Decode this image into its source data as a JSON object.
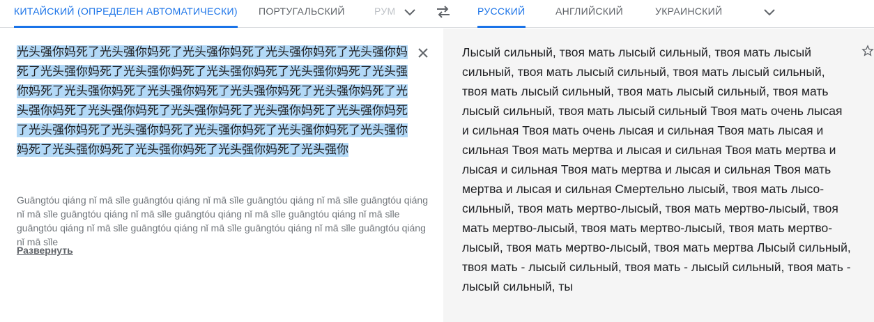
{
  "source_langs": {
    "detected": "КИТАЙСКИЙ (ОПРЕДЕЛЕН АВТОМАТИЧЕСКИ)",
    "portuguese": "ПОРТУГАЛЬСКИЙ",
    "partial": "РУМЫНСКИЙ"
  },
  "target_langs": {
    "russian": "РУССКИЙ",
    "english": "АНГЛИЙСКИЙ",
    "ukrainian": "УКРАИНСКИЙ"
  },
  "icons": {
    "more_source": "chevron-down-icon",
    "swap": "swap-arrows-icon",
    "more_target": "chevron-down-icon",
    "clear": "close-icon",
    "save": "star-icon"
  },
  "colors": {
    "accent": "#1a73e8",
    "selection": "#b3d9f7",
    "output_bg": "#f5f5f5"
  },
  "source": {
    "text": "光头强你妈死了光头强你妈死了光头强你妈死了光头强你妈死了光头强你妈死了光头强你妈死了光头强你妈死了光头强你妈死了光头强你妈死了光头强你妈死了光头强你妈死了光头强你妈死了光头强你妈死了光头强你妈死了光头强你妈死了光头强你妈死了光头强你妈死了光头强你妈死了光头强你妈死了光头强你妈死了光头强你妈死了光头强你妈死了光头强你妈死了光头强你妈死了光头强你妈死了光头强你妈死了光头强你妈死了光头强你",
    "transliteration": "Guāngtóu qiáng nǐ mā sǐle guāngtóu qiáng nǐ mā sǐle guāngtóu qiáng nǐ mā sǐle guāngtóu qiáng nǐ mā sǐle guāngtóu qiáng nǐ mā sǐle guāngtóu qiáng nǐ mā sǐle guāngtóu qiáng nǐ mā sǐle guāngtóu qiáng nǐ mā sǐle guāngtóu qiáng nǐ mā sǐle guāngtóu qiáng nǐ mā sǐle guāngtóu qiáng nǐ mā sǐle",
    "expand_label": "Развернуть"
  },
  "translation": {
    "text": "Лысый сильный, твоя мать лысый сильный, твоя мать лысый сильный, твоя мать лысый сильный, твоя мать лысый сильный, твоя мать лысый сильный, твоя мать лысый сильный, твоя мать лысый сильный, твоя мать лысый сильный Твоя мать очень лысая и сильная Твоя мать очень лысая и сильная Твоя мать лысая и сильная Твоя мать мертва и лысая и сильная Твоя мать мертва и лысая и сильная Твоя мать мертва и лысая и сильная Твоя мать мертва и лысая и сильная Смертельно лысый, твоя мать лысо-сильный, твоя мать мертво-лысый, твоя мать мертво-лысый, твоя мать мертво-лысый, твоя мать мертво-лысый, твоя мать мертво-лысый, твоя мать мертво-лысый, твоя мать мертва Лысый сильный, твоя мать - лысый сильный, твоя мать - лысый сильный, твоя мать - лысый сильный, ты"
  }
}
